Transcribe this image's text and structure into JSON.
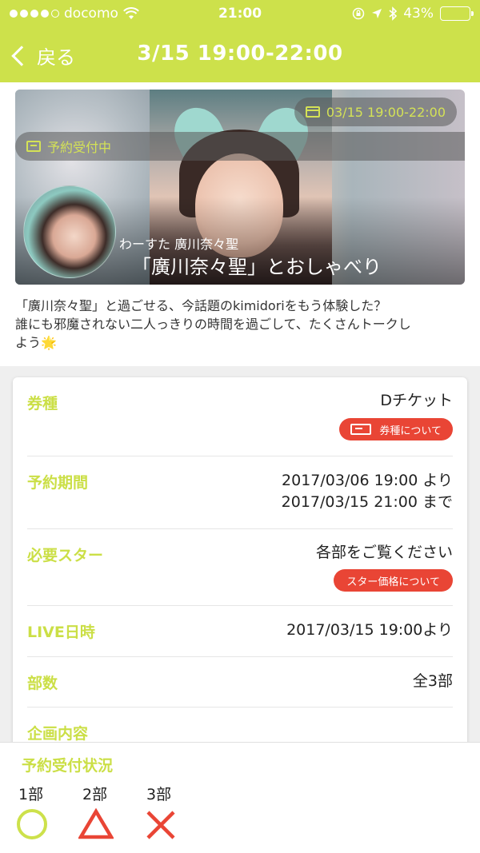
{
  "status_bar": {
    "carrier": "docomo",
    "time": "21:00",
    "battery": "43%",
    "battery_level": 0.43
  },
  "nav": {
    "back_label": "戻る",
    "title": "3/15 19:00-22:00"
  },
  "hero": {
    "date_pill": "03/15 19:00-22:00",
    "status_pill": "予約受付中",
    "subtitle": "わーすた 廣川奈々聖",
    "headline": "「廣川奈々聖」とおしゃべり"
  },
  "description": {
    "line1": "「廣川奈々聖」と過ごせる、今話題のkimidoriをもう体験した？",
    "line2": "誰にも邪魔されない二人っきりの時間を過ごして、たくさんトークし",
    "line3": "よう",
    "emoji": "🌟"
  },
  "details": {
    "ticket_type": {
      "label": "券種",
      "value": "Dチケット",
      "button": "券種について"
    },
    "reservation_period": {
      "label": "予約期間",
      "value_from": "2017/03/06 19:00 より",
      "value_to": "2017/03/15 21:00 まで"
    },
    "required_stars": {
      "label": "必要スター",
      "value": "各部をご覧ください",
      "button": "スター価格について"
    },
    "live_datetime": {
      "label": "LIVE日時",
      "value": "2017/03/15 19:00より"
    },
    "parts_count": {
      "label": "部数",
      "value": "全3部"
    },
    "plan": {
      "label": "企画内容"
    }
  },
  "reservation_status": {
    "label": "予約受付状況",
    "parts": [
      {
        "name": "1部",
        "mark": "circle",
        "color": "#cde14b"
      },
      {
        "name": "2部",
        "mark": "triangle",
        "color": "#e94535"
      },
      {
        "name": "3部",
        "mark": "cross",
        "color": "#e94535"
      }
    ]
  },
  "colors": {
    "accent": "#cde14b",
    "alert": "#e94535"
  }
}
